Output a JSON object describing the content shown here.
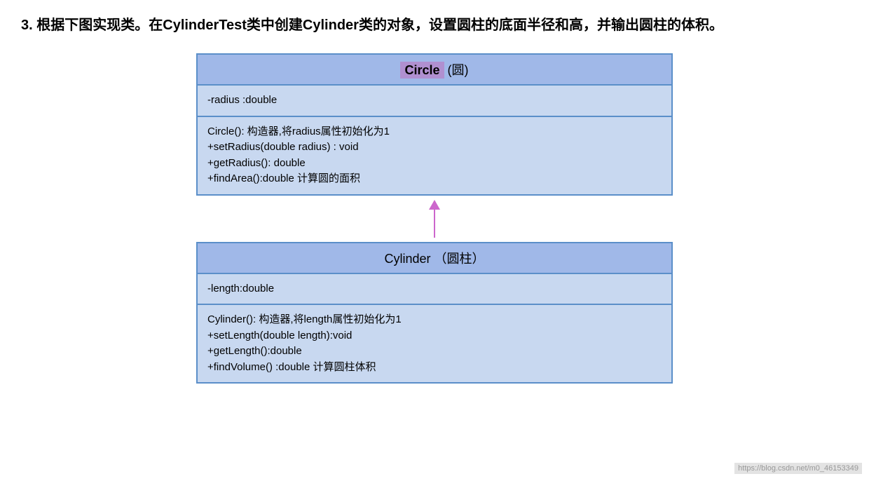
{
  "heading": {
    "text": "3. 根据下图实现类。在CylinderTest类中创建Cylinder类的对象，设置圆柱的底面半径和高，并输出圆柱的体积。",
    "prefix": "3. 根据下图实现类。在",
    "bold1": "CylinderTest",
    "middle": "类中创建",
    "bold2": "Cylinder",
    "suffix": "类的对象，设置圆柱的底面半径和高，并输出圆柱的体积。"
  },
  "circle_class": {
    "name_highlight": "Circle",
    "name_rest": " (圆)",
    "attributes": [
      "-radius :double"
    ],
    "methods": [
      "Circle(): 构造器,将radius属性初始化为1",
      "+setRadius(double radius) : void",
      "+getRadius(): double",
      "+findArea():double  计算圆的面积"
    ]
  },
  "cylinder_class": {
    "name": "Cylinder  （圆柱）",
    "attributes": [
      "-length:double"
    ],
    "methods": [
      "Cylinder():  构造器,将length属性初始化为1",
      "+setLength(double length):void",
      "+getLength():double",
      "+findVolume() :double  计算圆柱体积"
    ]
  },
  "watermark": "https://blog.csdn.net/m0_46153349"
}
